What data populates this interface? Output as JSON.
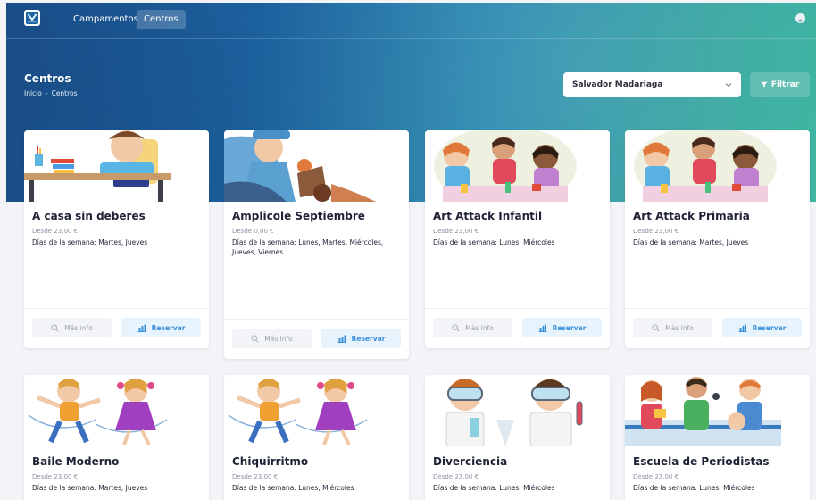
{
  "nav": {
    "logo_letter": "M",
    "links": [
      {
        "label": "Campamentos",
        "active": false
      },
      {
        "label": "Centros",
        "active": true
      }
    ]
  },
  "header": {
    "title": "Centros",
    "breadcrumb": [
      "Inicio",
      "-",
      "Centros"
    ]
  },
  "filter": {
    "school_select_value": "Salvador Madariaga",
    "filter_button_label": "Filtrar"
  },
  "buttons": {
    "info_label": "Más info",
    "reserve_label": "Reservar"
  },
  "cards": [
    {
      "title": "A casa sin deberes",
      "price": "Desde 23,00 €",
      "days": "Días de la semana: Martes, Jueves"
    },
    {
      "title": "Amplicole Septiembre",
      "price": "Desde 0,00 €",
      "days": "Días de la semana: Lunes, Martes, Miércoles, Jueves, Viernes"
    },
    {
      "title": "Art Attack Infantil",
      "price": "Desde 23,00 €",
      "days": "Días de la semana: Lunes, Miércoles"
    },
    {
      "title": "Art Attack Primaria",
      "price": "Desde 23,00 €",
      "days": "Días de la semana: Martes, Jueves"
    },
    {
      "title": "Baile Moderno",
      "price": "Desde 23,00 €",
      "days": "Días de la semana: Martes, Jueves"
    },
    {
      "title": "Chiquirritmo",
      "price": "Desde 23,00 €",
      "days": "Días de la semana: Lunes, Miércoles"
    },
    {
      "title": "Diverciencia",
      "price": "Desde 23,00 €",
      "days": "Días de la semana: Lunes, Miércoles"
    },
    {
      "title": "Escuela de Periodistas",
      "price": "Desde 23,00 €",
      "days": "Días de la semana: Lunes, Miércoles"
    }
  ],
  "colors": {
    "accent": "#3a8fd8",
    "hero_start": "#1a4f8c",
    "hero_end": "#3bb5a0"
  }
}
